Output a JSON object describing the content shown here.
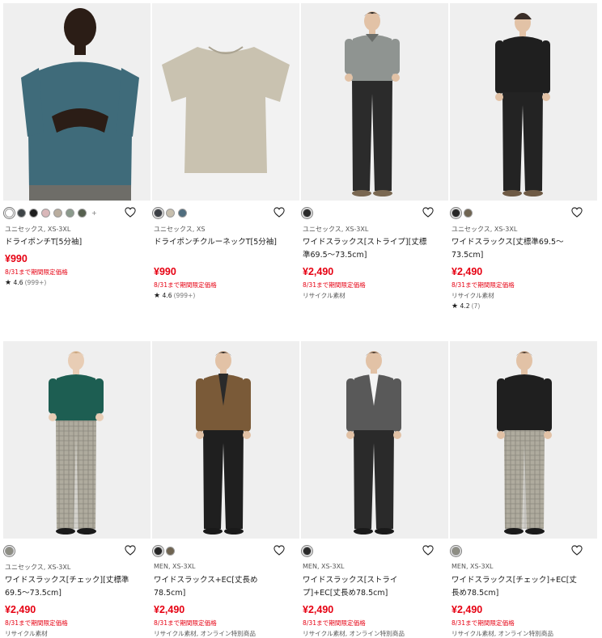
{
  "colors": {
    "price": "#e60012",
    "text": "#1b1b1b",
    "muted": "#555555"
  },
  "products": [
    {
      "image": "teal-tshirt-model",
      "swatches": [
        "#ffffff",
        "#3e4447",
        "#1e1e1e",
        "#d9b7b9",
        "#b9ad9e",
        "#8b9a8c",
        "#56604f"
      ],
      "more": "+",
      "meta": "ユニセックス, XS-3XL",
      "name": "ドライポンチT[5分袖]",
      "price": "¥990",
      "promo": "8/31まで期間限定価格",
      "attr": "",
      "rating_star": "★",
      "rating": "4.6",
      "rating_count": "(999+)"
    },
    {
      "image": "beige-tshirt-flat",
      "swatches": [
        "#3b3f45",
        "#c7bfae",
        "#4f6d7e"
      ],
      "more": "",
      "meta": "ユニセックス, XS",
      "name": "ドライポンチクルーネックT[5分袖]",
      "price": "¥990",
      "promo": "8/31まで期間限定価格",
      "attr": "",
      "rating_star": "★",
      "rating": "4.6",
      "rating_count": "(999+)"
    },
    {
      "image": "grey-polo-slacks-model",
      "swatches": [
        "#2a2a2a"
      ],
      "more": "",
      "meta": "ユニセックス, XS-3XL",
      "name": "ワイドスラックス[ストライプ][丈標準69.5〜73.5cm]",
      "price": "¥2,490",
      "promo": "8/31まで期間限定価格",
      "attr": "リサイクル素材",
      "rating_star": "",
      "rating": "",
      "rating_count": ""
    },
    {
      "image": "black-jacket-slacks-model",
      "swatches": [
        "#262626",
        "#6f6451"
      ],
      "more": "",
      "meta": "ユニセックス, XS-3XL",
      "name": "ワイドスラックス[丈標準69.5〜73.5cm]",
      "price": "¥2,490",
      "promo": "8/31まで期間限定価格",
      "attr": "リサイクル素材",
      "rating_star": "★",
      "rating": "4.2",
      "rating_count": "(7)"
    },
    {
      "image": "green-tee-check-slacks-model",
      "swatches": [
        "#8e8e84"
      ],
      "more": "",
      "meta": "ユニセックス, XS-3XL",
      "name": "ワイドスラックス[チェック][丈標準69.5〜73.5cm]",
      "price": "¥2,490",
      "promo": "8/31まで期間限定価格",
      "attr": "リサイクル素材",
      "rating_star": "",
      "rating": "",
      "rating_count": ""
    },
    {
      "image": "brown-jacket-black-slacks-model",
      "swatches": [
        "#262626",
        "#6f6451"
      ],
      "more": "",
      "meta": "MEN, XS-3XL",
      "name": "ワイドスラックス+EC[丈長め78.5cm]",
      "price": "¥2,490",
      "promo": "8/31まで期間限定価格",
      "attr": "リサイクル素材, オンライン特別商品",
      "rating_star": "",
      "rating": "",
      "rating_count": ""
    },
    {
      "image": "grey-jacket-black-slacks-model",
      "swatches": [
        "#2a2a2a"
      ],
      "more": "",
      "meta": "MEN, XS-3XL",
      "name": "ワイドスラックス[ストライプ]+EC[丈長め78.5cm]",
      "price": "¥2,490",
      "promo": "8/31まで期間限定価格",
      "attr": "リサイクル素材, オンライン特別商品",
      "rating_star": "",
      "rating": "",
      "rating_count": ""
    },
    {
      "image": "black-jacket-check-slacks-model",
      "swatches": [
        "#8e8e84"
      ],
      "more": "",
      "meta": "MEN, XS-3XL",
      "name": "ワイドスラックス[チェック]+EC[丈長め78.5cm]",
      "price": "¥2,490",
      "promo": "8/31まで期間限定価格",
      "attr": "リサイクル素材, オンライン特別商品",
      "rating_star": "",
      "rating": "",
      "rating_count": ""
    }
  ]
}
